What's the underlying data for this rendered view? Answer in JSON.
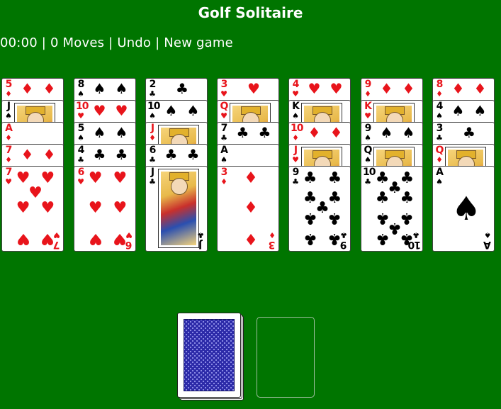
{
  "header": {
    "title": "Golf Solitaire"
  },
  "toolbar": {
    "timer": "00:00",
    "moves": "0 Moves",
    "undo_label": "Undo",
    "new_game_label": "New game",
    "separator": " | "
  },
  "colors": {
    "felt": "#007500",
    "red_suit": "#e8141b",
    "black_suit": "#000000",
    "card_back": "#2c2aa8"
  },
  "tableau": [
    [
      {
        "rank": "5",
        "suit": "♦"
      },
      {
        "rank": "J",
        "suit": "♠"
      },
      {
        "rank": "A",
        "suit": "♦"
      },
      {
        "rank": "7",
        "suit": "♦"
      },
      {
        "rank": "7",
        "suit": "♥"
      }
    ],
    [
      {
        "rank": "8",
        "suit": "♠"
      },
      {
        "rank": "10",
        "suit": "♥"
      },
      {
        "rank": "5",
        "suit": "♠"
      },
      {
        "rank": "4",
        "suit": "♣"
      },
      {
        "rank": "6",
        "suit": "♥"
      }
    ],
    [
      {
        "rank": "2",
        "suit": "♣"
      },
      {
        "rank": "10",
        "suit": "♠"
      },
      {
        "rank": "J",
        "suit": "♦"
      },
      {
        "rank": "6",
        "suit": "♣"
      },
      {
        "rank": "J",
        "suit": "♣"
      }
    ],
    [
      {
        "rank": "3",
        "suit": "♥"
      },
      {
        "rank": "Q",
        "suit": "♥"
      },
      {
        "rank": "7",
        "suit": "♣"
      },
      {
        "rank": "A",
        "suit": "♠"
      },
      {
        "rank": "3",
        "suit": "♦"
      }
    ],
    [
      {
        "rank": "4",
        "suit": "♥"
      },
      {
        "rank": "K",
        "suit": "♠"
      },
      {
        "rank": "10",
        "suit": "♦"
      },
      {
        "rank": "J",
        "suit": "♥"
      },
      {
        "rank": "9",
        "suit": "♣"
      }
    ],
    [
      {
        "rank": "9",
        "suit": "♦"
      },
      {
        "rank": "K",
        "suit": "♥"
      },
      {
        "rank": "9",
        "suit": "♠"
      },
      {
        "rank": "Q",
        "suit": "♠"
      },
      {
        "rank": "10",
        "suit": "♣"
      }
    ],
    [
      {
        "rank": "8",
        "suit": "♦"
      },
      {
        "rank": "4",
        "suit": "♠"
      },
      {
        "rank": "3",
        "suit": "♣"
      },
      {
        "rank": "Q",
        "suit": "♦"
      },
      {
        "rank": "A",
        "suit": "♠"
      }
    ]
  ],
  "stock": {
    "icon": "card-back"
  },
  "waste": {
    "state": "empty"
  }
}
